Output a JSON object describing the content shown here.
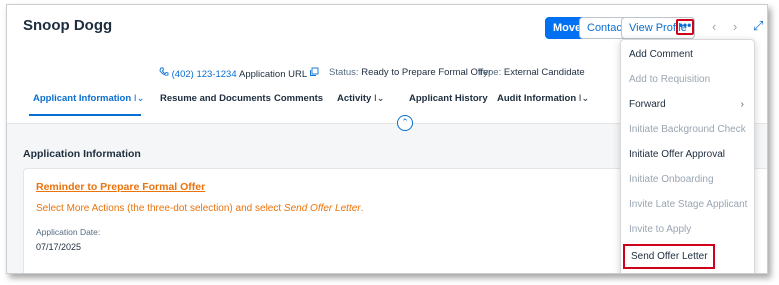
{
  "header": {
    "title": "Snoop Dogg",
    "move_label": "Move",
    "contact_label": "Contact",
    "view_profile_label": "View Profile",
    "more_label": "•••",
    "prev_label": "‹",
    "next_label": "›",
    "expand_label": "⤢"
  },
  "info": {
    "phone": "(402) 123-1234",
    "application_url": "Application URL",
    "status_label": "Status:",
    "status_value": "Ready to Prepare Formal Offer",
    "type_label": "Type:",
    "type_value": "External Candidate"
  },
  "tabs": [
    {
      "label": "Applicant Information"
    },
    {
      "label": "Resume and Documents"
    },
    {
      "label": "Comments"
    },
    {
      "label": "Activity"
    },
    {
      "label": "Applicant History"
    },
    {
      "label": "Audit Information"
    }
  ],
  "section": {
    "title": "Application Information",
    "reminder_title": "Reminder to Prepare Formal Offer",
    "reminder_text_prefix": "Select More Actions (the three-dot selection) and select ",
    "reminder_text_emph": "Send Offer Letter",
    "reminder_text_suffix": ".",
    "date_label": "Application Date:",
    "date_value": "07/17/2025"
  },
  "menu": {
    "items": [
      {
        "label": "Add Comment"
      },
      {
        "label": "Add to Requisition"
      },
      {
        "label": "Forward"
      },
      {
        "label": "Initiate Background Check"
      },
      {
        "label": "Initiate Offer Approval"
      },
      {
        "label": "Initiate Onboarding"
      },
      {
        "label": "Invite Late Stage Applicant"
      },
      {
        "label": "Invite to Apply"
      },
      {
        "label": "Send Offer Letter"
      }
    ]
  },
  "icons": {
    "phone": "phone-icon",
    "copy": "copy-icon",
    "chevron": "chevron-down-icon",
    "collapse": "chevron-up-icon"
  }
}
